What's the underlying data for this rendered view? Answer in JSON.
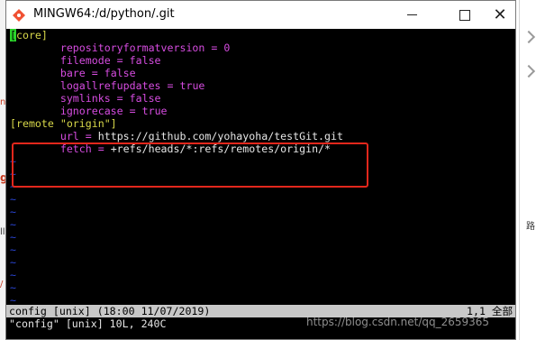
{
  "window": {
    "title": "MINGW64:/d/python/.git",
    "close_glyph": "✕"
  },
  "editor": {
    "sections": [
      {
        "header": "[core]",
        "entries": [
          {
            "key": "repositoryformatversion",
            "op": " = ",
            "value": "0"
          },
          {
            "key": "filemode",
            "op": " = ",
            "value": "false"
          },
          {
            "key": "bare",
            "op": " = ",
            "value": "false"
          },
          {
            "key": "logallrefupdates",
            "op": " = ",
            "value": "true"
          },
          {
            "key": "symlinks",
            "op": " = ",
            "value": "false"
          },
          {
            "key": "ignorecase",
            "op": " = ",
            "value": "true"
          }
        ]
      },
      {
        "header": "[remote \"origin\"]",
        "entries": [
          {
            "key": "url",
            "op": " = ",
            "value": "https://github.com/yohayoha/testGit.git"
          },
          {
            "key": "fetch",
            "op": " = ",
            "value": "+refs/heads/*:refs/remotes/origin/*"
          }
        ]
      }
    ],
    "empty_line_marker": "~",
    "status": {
      "left": "config [unix] (18:00 11/07/2019)",
      "right": "1,1 全部"
    },
    "message": "\"config\" [unix] 10L, 240C"
  },
  "watermark": "https://blog.csdn.net/qq_2659365",
  "background": {
    "left_glyphs": [
      "no",
      "g",
      "ll",
      "/"
    ],
    "right_glyphs": [
      "路"
    ]
  },
  "colors": {
    "section": "#d8d84a",
    "key": "#d64ce0",
    "value": "#e6e6e6",
    "cursor": "#2ad32a",
    "tilde": "#2a46d6",
    "highlight": "#e2271c",
    "statusbar": "#c8c8c8"
  }
}
